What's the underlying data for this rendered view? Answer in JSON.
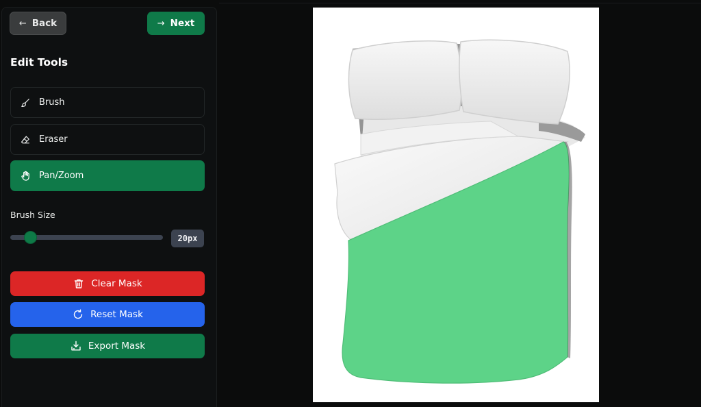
{
  "nav": {
    "back_label": "Back",
    "next_label": "Next"
  },
  "edit_tools": {
    "title": "Edit Tools",
    "tools": [
      {
        "label": "Brush",
        "icon": "brush-icon",
        "active": false
      },
      {
        "label": "Eraser",
        "icon": "eraser-icon",
        "active": false
      },
      {
        "label": "Pan/Zoom",
        "icon": "hand-icon",
        "active": true
      }
    ]
  },
  "brush_size": {
    "label": "Brush Size",
    "value_text": "20px",
    "fraction": 0.1
  },
  "actions": {
    "clear_label": "Clear Mask",
    "reset_label": "Reset Mask",
    "export_label": "Export Mask"
  },
  "colors": {
    "accent_green": "#0f7a49",
    "danger_red": "#dc2626",
    "primary_blue": "#2563eb",
    "mask_green": "#5dd388"
  },
  "canvas": {
    "image_subject": "bed with pillows and duvet",
    "mask_color": "#5dd388"
  }
}
